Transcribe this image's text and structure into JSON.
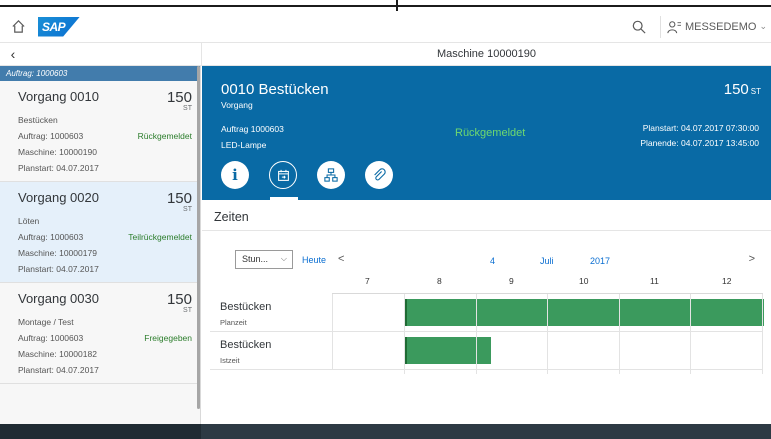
{
  "shell": {
    "brand": "SAP",
    "user": "MESSEDEMO"
  },
  "subheader": {
    "title": "Maschine 10000190"
  },
  "master": {
    "group_label": "Auftrag: 1000603",
    "items": [
      {
        "title": "Vorgang 0010",
        "qty": "150",
        "unit": "ST",
        "desc": "Bestücken",
        "auftrag": "Auftrag: 1000603",
        "status": "Rückgemeldet",
        "maschine": "Maschine: 10000190",
        "planstart": "Planstart: 04.07.2017"
      },
      {
        "title": "Vorgang 0020",
        "qty": "150",
        "unit": "ST",
        "desc": "Löten",
        "auftrag": "Auftrag: 1000603",
        "status": "Teilrückgemeldet",
        "maschine": "Maschine: 10000179",
        "planstart": "Planstart: 04.07.2017"
      },
      {
        "title": "Vorgang 0030",
        "qty": "150",
        "unit": "ST",
        "desc": "Montage / Test",
        "auftrag": "Auftrag: 1000603",
        "status": "Freigegeben",
        "maschine": "Maschine: 10000182",
        "planstart": "Planstart: 04.07.2017"
      }
    ]
  },
  "detail": {
    "title": "0010 Bestücken",
    "subtitle": "Vorgang",
    "qty": "150",
    "unit": "ST",
    "auftrag": "Auftrag 1000603",
    "material": "LED-Lampe",
    "status": "Rückgemeldet",
    "planstart": "Planstart: 04.07.2017 07:30:00",
    "planende": "Planende: 04.07.2017 13:45:00",
    "tabs": [
      {
        "icon": "info-icon",
        "glyph": "i"
      },
      {
        "icon": "calendar-icon",
        "glyph": "⇥"
      },
      {
        "icon": "hierarchy-icon",
        "glyph": "品"
      },
      {
        "icon": "attachment-icon",
        "glyph": "⌀"
      }
    ]
  },
  "zeiten": {
    "title": "Zeiten",
    "toolbar": {
      "zoom_value": "Stun...",
      "today": "Heute",
      "prev": "<",
      "next": ">",
      "day": "4",
      "month": "Juli",
      "year": "2017"
    },
    "hours": [
      "7",
      "8",
      "9",
      "10",
      "11",
      "12"
    ],
    "rows": [
      {
        "label": "Bestücken",
        "sub": "Planzeit",
        "start_hour": 7.5,
        "end_hour": 13.75
      },
      {
        "label": "Bestücken",
        "sub": "Istzeit",
        "start_hour": 7.5,
        "end_hour": 8.7
      }
    ],
    "colors": {
      "bar": "#3b9a5d",
      "header": "#096aa5",
      "status_green": "#2b7d2b"
    }
  }
}
